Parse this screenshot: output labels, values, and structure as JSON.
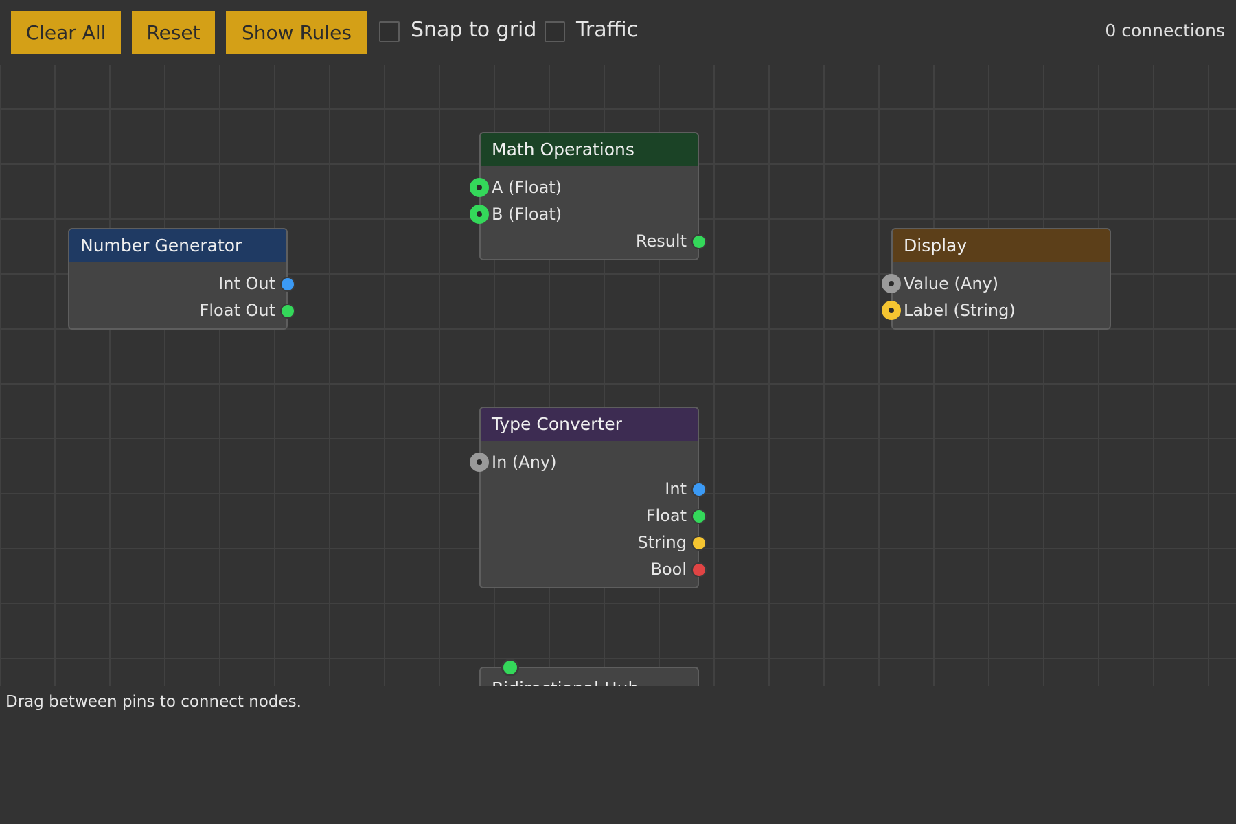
{
  "toolbar": {
    "clear_label": "Clear All",
    "reset_label": "Reset",
    "rules_label": "Show Rules",
    "snap_label": "Snap to grid",
    "traffic_label": "Traffic",
    "snap_checked": false,
    "traffic_checked": false,
    "connections_text": "0 connections"
  },
  "colors": {
    "button": "#d4a017",
    "int": "#3b9af5",
    "float": "#34d85a",
    "string": "#f5c531",
    "bool": "#e04444",
    "any": "#9a9a9a"
  },
  "nodes": {
    "number_generator": {
      "title": "Number Generator",
      "header_color": "#1f3a63",
      "outputs": [
        "Int Out",
        "Float Out"
      ]
    },
    "math_operations": {
      "title": "Math Operations",
      "header_color": "#1b4326",
      "inputs": [
        "A (Float)",
        "B (Float)"
      ],
      "outputs": [
        "Result"
      ]
    },
    "display": {
      "title": "Display",
      "header_color": "#5c3f19",
      "inputs": [
        "Value (Any)",
        "Label (String)"
      ]
    },
    "type_converter": {
      "title": "Type Converter",
      "header_color": "#3d2c52",
      "inputs": [
        "In (Any)"
      ],
      "outputs": [
        "Int",
        "Float",
        "String",
        "Bool"
      ]
    },
    "bidirectional_hub": {
      "title": "Bidirectional Hub"
    }
  },
  "footer": {
    "hint": "Drag between pins to connect nodes."
  }
}
